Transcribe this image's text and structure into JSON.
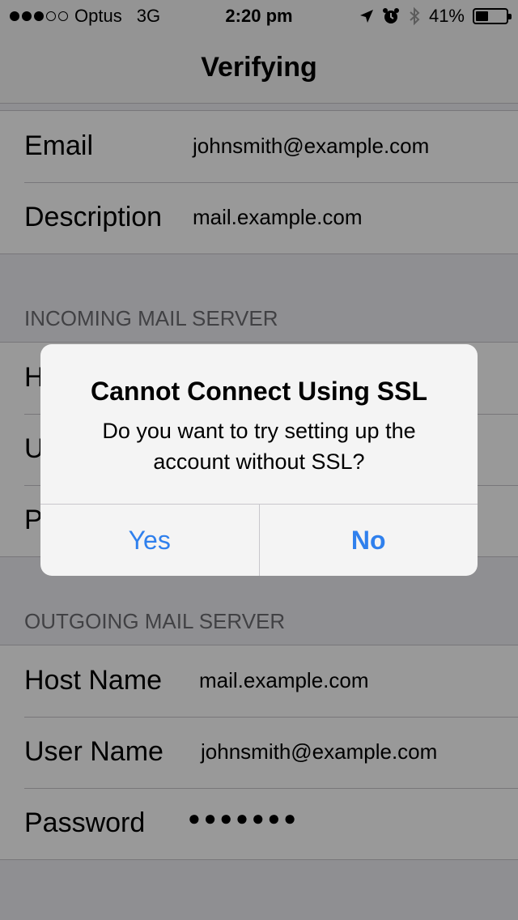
{
  "status_bar": {
    "carrier": "Optus",
    "network": "3G",
    "time": "2:20 pm",
    "battery": "41%",
    "battery_level": 0.41,
    "signal_bars": 3,
    "signal_max": 5,
    "icons": [
      "location-arrow-icon",
      "alarm-clock-icon",
      "bluetooth-icon",
      "battery-icon"
    ]
  },
  "nav": {
    "title": "Verifying"
  },
  "account": {
    "rows": [
      {
        "label": "Email",
        "value": "johnsmith@example.com"
      },
      {
        "label": "Description",
        "value": "mail.example.com"
      }
    ]
  },
  "incoming": {
    "header": "INCOMING MAIL SERVER",
    "rows": [
      {
        "label": "H"
      },
      {
        "label": "U"
      },
      {
        "label": "P"
      }
    ]
  },
  "outgoing": {
    "header": "OUTGOING MAIL SERVER",
    "rows": [
      {
        "label": "Host Name",
        "value": "mail.example.com"
      },
      {
        "label": "User Name",
        "value": "johnsmith@example.com"
      },
      {
        "label": "Password",
        "value": "●●●●●●●"
      }
    ]
  },
  "alert": {
    "title": "Cannot Connect Using SSL",
    "message": "Do you want to try setting up the account without SSL?",
    "buttons": {
      "yes": "Yes",
      "no": "No"
    }
  },
  "colors": {
    "accent": "#2f80ed",
    "background": "#efeff4",
    "separator": "#c8c7cc"
  }
}
